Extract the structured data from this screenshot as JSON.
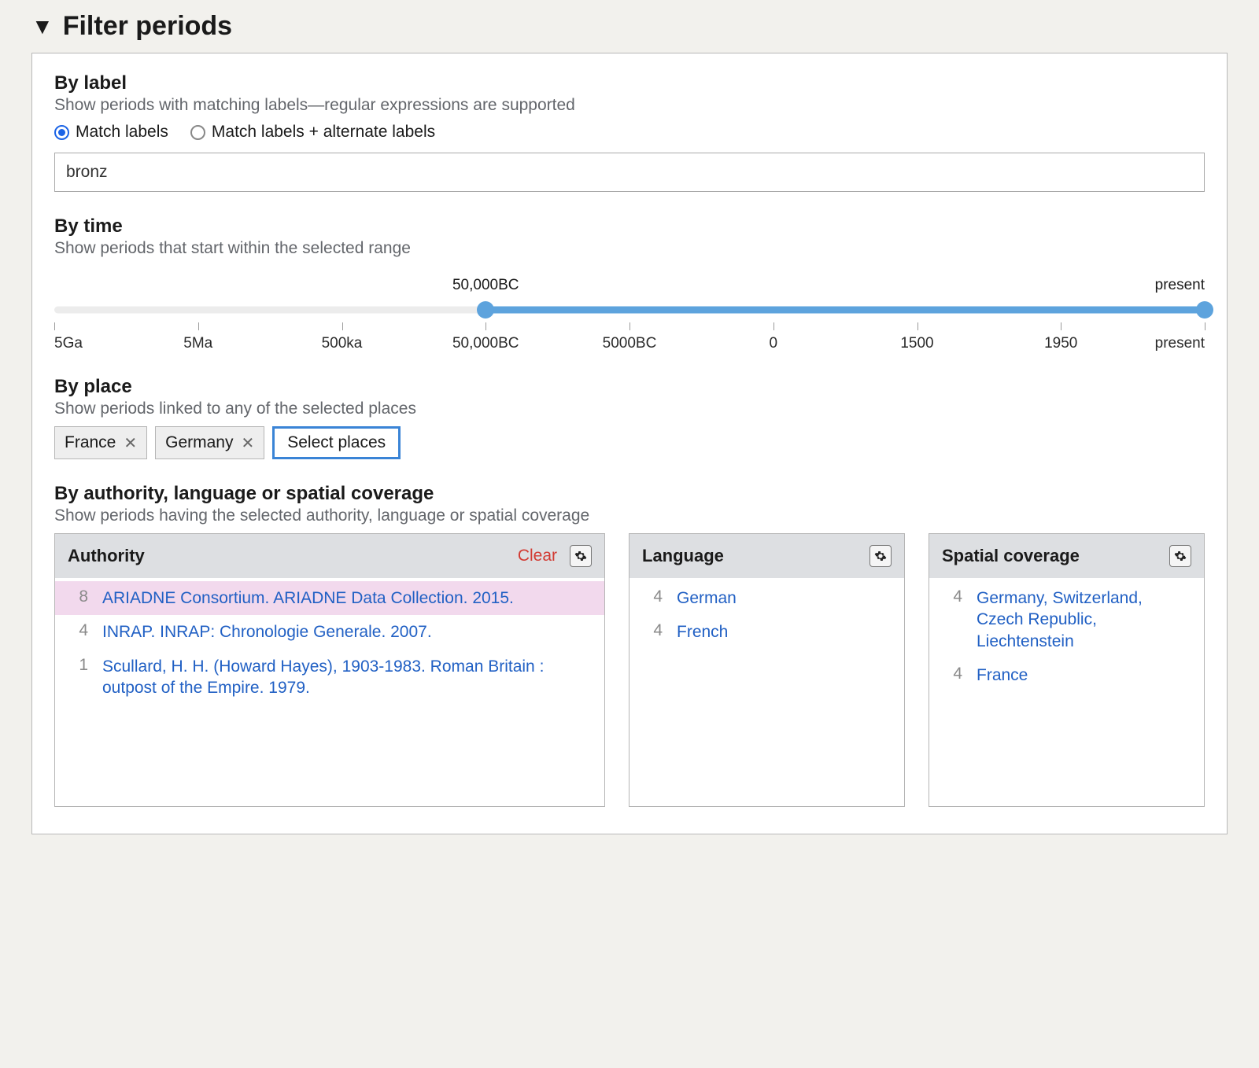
{
  "title": "Filter periods",
  "by_label": {
    "title": "By label",
    "desc": "Show periods with matching labels—regular expressions are supported",
    "radios": {
      "match_labels": "Match labels",
      "match_alt": "Match labels + alternate labels",
      "selected": "match_labels"
    },
    "input_value": "bronz"
  },
  "by_time": {
    "title": "By time",
    "desc": "Show periods that start within the selected range",
    "range_start_label": "50,000BC",
    "range_end_label": "present",
    "ticks": [
      "5Ga",
      "5Ma",
      "500ka",
      "50,000BC",
      "5000BC",
      "0",
      "1500",
      "1950",
      "present"
    ]
  },
  "by_place": {
    "title": "By place",
    "desc": "Show periods linked to any of the selected places",
    "chips": [
      "France",
      "Germany"
    ],
    "select_label": "Select places"
  },
  "by_facet": {
    "title": "By authority, language or spatial coverage",
    "desc": "Show periods having the selected authority, language or spatial coverage",
    "authority": {
      "title": "Authority",
      "clear": "Clear",
      "rows": [
        {
          "count": "8",
          "label": "ARIADNE Consortium. ARIADNE Data Collection. 2015.",
          "selected": true
        },
        {
          "count": "4",
          "label": "INRAP. INRAP: Chronologie Generale. 2007.",
          "selected": false
        },
        {
          "count": "1",
          "label": "Scullard, H. H. (Howard Hayes), 1903-1983. Roman Britain : outpost of the Empire. 1979.",
          "selected": false
        }
      ]
    },
    "language": {
      "title": "Language",
      "rows": [
        {
          "count": "4",
          "label": "German"
        },
        {
          "count": "4",
          "label": "French"
        }
      ]
    },
    "spatial": {
      "title": "Spatial coverage",
      "rows": [
        {
          "count": "4",
          "label": "Germany, Switzerland, Czech Republic, Liechtenstein"
        },
        {
          "count": "4",
          "label": "France"
        }
      ]
    }
  }
}
